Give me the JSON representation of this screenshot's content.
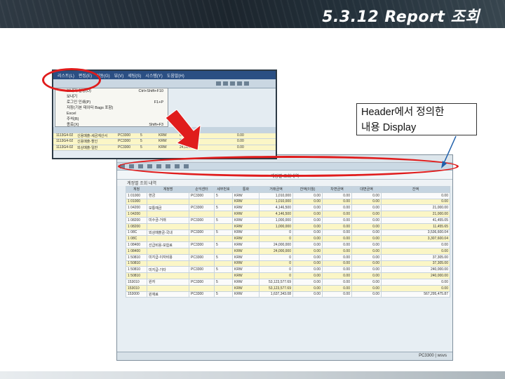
{
  "slide": {
    "title": "5.3.12 Report 조회",
    "callout_line1": "Header에서 정의한",
    "callout_line2": "내용 Display"
  },
  "colors": {
    "annotation": "#e01c1c",
    "arrow_fill": "#e01c1c",
    "banner": "#1c252d"
  },
  "popup_menu": {
    "menubar": [
      "리스트(L)",
      "편집(E)",
      "이동(G)",
      "뷰(V)",
      "세팅(S)",
      "시스템(Y)",
      "도움말(H)"
    ],
    "items": [
      {
        "label": "보내기 설정(O)",
        "shortcut": "Ctrl+Shift+F10"
      },
      {
        "label": "보내기",
        "shortcut": ""
      },
      {
        "label": "로그인 인쇄(P)",
        "shortcut": "F1+P"
      },
      {
        "label": "저장(기본 데이터 Bags 포함)",
        "shortcut": ""
      },
      {
        "label": "Excel",
        "shortcut": ""
      },
      {
        "label": "주석(B)",
        "shortcut": ""
      },
      {
        "label": "종료(X)",
        "shortcut": "Shift+F3"
      }
    ],
    "grid_rows": [
      {
        "c1": "1113G4-02",
        "c2": "신용매출-세금계산서",
        "c3": "PC3300",
        "c4": "5",
        "c5": "KRW",
        "c6": "0",
        "c7": "0.00"
      },
      {
        "c1": "1113G4-02",
        "c2": "신용매출-할인",
        "c3": "PC3300",
        "c4": "5",
        "c5": "KRW",
        "c6": "24,000,000",
        "c7": "0.00"
      },
      {
        "c1": "1113G4-02",
        "c2": "외상매출-일반",
        "c3": "PC3300",
        "c4": "5",
        "c5": "KRW",
        "c6": "24,000,000",
        "c7": "0.00"
      }
    ]
  },
  "report": {
    "title": "계정별 조회내역",
    "subheader": "계정별 조회 내역",
    "columns": [
      "계정",
      "계정명",
      "손익센터",
      "세부번호",
      "통화",
      "거래금액",
      "잔액(이월)",
      "차변금액",
      "대변금액",
      "잔액"
    ],
    "rows": [
      {
        "style": "w",
        "cells": [
          "1 01000",
          "현금",
          "PC3300",
          "5",
          "KRW",
          "1,010,000",
          "0.00",
          "0.00",
          "0.00",
          "0.00"
        ]
      },
      {
        "style": "y",
        "cells": [
          "1 01000",
          "",
          "",
          "",
          "KRW",
          "1,010,000",
          "0.00",
          "0.00",
          "0.00",
          "0.00"
        ]
      },
      {
        "style": "w",
        "cells": [
          "1 04200",
          "보통예금",
          "PC3300",
          "5",
          "KRW",
          "4,146,500",
          "0.00",
          "0.00",
          "0.00",
          "21,000.00"
        ]
      },
      {
        "style": "y",
        "cells": [
          "1 04200",
          "",
          "",
          "",
          "KRW",
          "4,146,500",
          "0.00",
          "0.00",
          "0.00",
          "21,000.00"
        ]
      },
      {
        "style": "w",
        "cells": [
          "1 08200",
          "미수금-거래",
          "PC3300",
          "5",
          "KRW",
          "1,000,000",
          "0.00",
          "0.00",
          "0.00",
          "41,455.05"
        ]
      },
      {
        "style": "y",
        "cells": [
          "1 08200",
          "",
          "",
          "",
          "KRW",
          "1,000,000",
          "0.00",
          "0.00",
          "0.00",
          "11,455.65"
        ]
      },
      {
        "style": "w",
        "cells": [
          "1 08C",
          "외상매출금-국내",
          "PC3300",
          "5",
          "KRW",
          "0",
          "0.00",
          "0.00",
          "0.00",
          "3,536,600.04"
        ]
      },
      {
        "style": "y",
        "cells": [
          "1 08C",
          "",
          "",
          "",
          "KRW",
          "0",
          "0.00",
          "0.00",
          "0.00",
          "3,307,600.04"
        ]
      },
      {
        "style": "w",
        "cells": [
          "1 08400",
          "선급비용-보험료",
          "PC3300",
          "5",
          "KRW",
          "24,000,000",
          "0.00",
          "0.00",
          "0.00",
          "0.00"
        ]
      },
      {
        "style": "y",
        "cells": [
          "1 08400",
          "",
          "",
          "",
          "KRW",
          "24,000,000",
          "0.00",
          "0.00",
          "0.00",
          "0.00"
        ]
      },
      {
        "style": "w",
        "cells": [
          "1 50810",
          "미지급-이자비용",
          "PC3300",
          "5",
          "KRW",
          "0",
          "0.00",
          "0.00",
          "0.00",
          "37,305.00"
        ]
      },
      {
        "style": "y",
        "cells": [
          "1 50810",
          "",
          "",
          "",
          "KRW",
          "0",
          "0.00",
          "0.00",
          "0.00",
          "37,305.00"
        ]
      },
      {
        "style": "w",
        "cells": [
          "1 50810",
          "미지급-기타",
          "PC3300",
          "5",
          "KRW",
          "0",
          "0.00",
          "0.00",
          "0.00",
          "240,000.00"
        ]
      },
      {
        "style": "y",
        "cells": [
          "1 50810",
          "",
          "",
          "",
          "KRW",
          "0",
          "0.00",
          "0.00",
          "0.00",
          "240,000.00"
        ]
      },
      {
        "style": "w",
        "cells": [
          "153010",
          "원자",
          "PC3300",
          "5",
          "KRW",
          "53,123,577.69",
          "0.00",
          "0.00",
          "0.00",
          "0.00"
        ]
      },
      {
        "style": "y",
        "cells": [
          "153010",
          "",
          "",
          "",
          "KRW",
          "53,123,577.69",
          "0.00",
          "0.00",
          "0.00",
          "0.00"
        ]
      },
      {
        "style": "w",
        "cells": [
          "153000",
          "원재료",
          "PC3300",
          "5",
          "KRW",
          "1,637,343.08",
          "0.00",
          "0.00",
          "0.00",
          "567,295,475.87"
        ]
      }
    ],
    "status": "PC3300 | wsvs"
  }
}
